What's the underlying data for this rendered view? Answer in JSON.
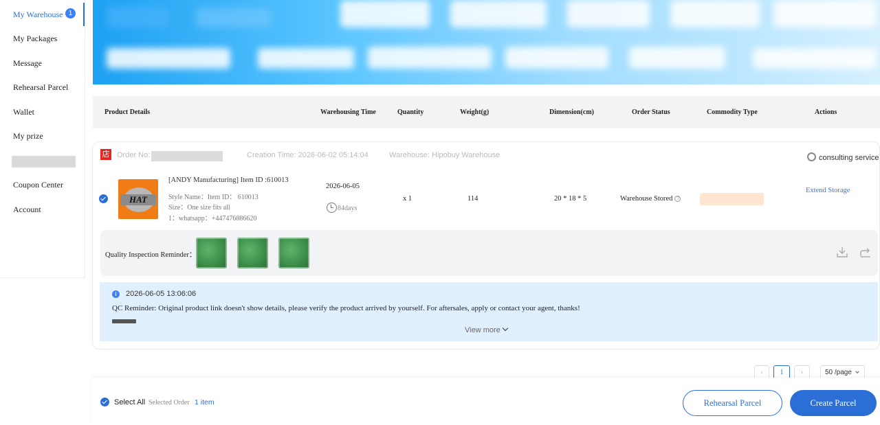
{
  "sidebar": {
    "items": [
      {
        "label": "My Warehouse",
        "badge": "1",
        "active": true
      },
      {
        "label": "My Packages"
      },
      {
        "label": "Message"
      },
      {
        "label": "Rehearsal Parcel"
      },
      {
        "label": "Wallet"
      },
      {
        "label": "My prize"
      },
      {
        "label": "Coupon Center"
      },
      {
        "label": "Account"
      }
    ]
  },
  "table": {
    "headers": {
      "product_details": "Product Details",
      "warehousing_time": "Warehousing Time",
      "quantity": "Quantity",
      "weight": "Weight(g)",
      "dimension": "Dimension(cm)",
      "order_status": "Order Status",
      "commodity_type": "Commodity Type",
      "actions": "Actions"
    }
  },
  "order": {
    "shop_icon": "店",
    "order_no_label": "Order No:",
    "creation_time": "Creation Time: 2026-06-02 05:14:04",
    "warehouse": "Warehouse: Hipobuy Warehouse",
    "consulting": "consulting service",
    "product": {
      "image_text": "HAT",
      "name": "[ANDY Manufacturing] Item ID :610013",
      "style": "Style Name：Item ID： 610013",
      "size": "Size：One size fits all",
      "note": "1：whatsapp：+447476886620",
      "warehousing_date": "2026-06-05",
      "days": "84days",
      "quantity": "x 1",
      "weight": "114",
      "dimension": "20 * 18 * 5",
      "status": "Warehouse Stored",
      "status_help": "?",
      "action": "Extend Storage"
    },
    "qc": {
      "label": "Quality Inspection Reminder：",
      "thumb_count": 3
    },
    "notice": {
      "icon": "i",
      "date": "2026-06-05 13:06:06",
      "text": "QC Reminder: Original product link doesn't show details, please verify the product arrived by yourself. For aftersales, apply or contact your agent, thanks!",
      "view_more": "View more"
    }
  },
  "pagination": {
    "prev": "‹",
    "current": "1",
    "next": "›",
    "page_size": "50 /page"
  },
  "footer": {
    "select_all": "Select All",
    "selected_order": "Selected Order",
    "selected_count": "1 item",
    "rehearsal_button": "Rehearsal Parcel",
    "create_button": "Create Parcel"
  },
  "colors": {
    "primary": "#2b6fd6",
    "shop_red": "#e5251e",
    "notice_bg": "#e1f0ff"
  }
}
